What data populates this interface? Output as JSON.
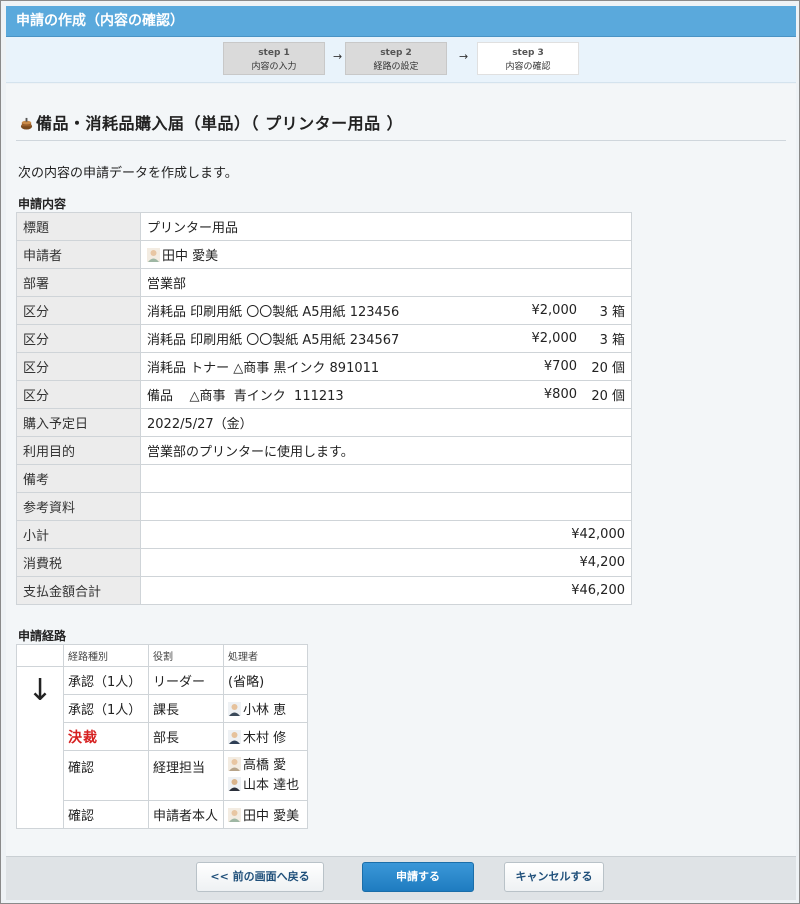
{
  "window": {
    "title": "申請の作成（内容の確認）"
  },
  "steps": [
    {
      "step": "step 1",
      "label": "内容の入力"
    },
    {
      "step": "step 2",
      "label": "経路の設定"
    },
    {
      "step": "step 3",
      "label": "内容の確認"
    }
  ],
  "arrow_glyph": "→",
  "form": {
    "title": "備品・消耗品購入届（単品）（ プリンター用品 ）",
    "intro": "次の内容の申請データを作成します。",
    "section_content": "申請内容",
    "rows": {
      "title": {
        "label": "標題",
        "value": "プリンター用品"
      },
      "applicant": {
        "label": "申請者",
        "value": "田中 愛美"
      },
      "dept": {
        "label": "部署",
        "value": "営業部"
      },
      "items": [
        {
          "label": "区分",
          "desc": "消耗品  印刷用紙  〇〇製紙  A5用紙  123456",
          "price": "¥2,000",
          "qty": "3  箱"
        },
        {
          "label": "区分",
          "desc": "消耗品  印刷用紙  〇〇製紙  A5用紙  234567",
          "price": "¥2,000",
          "qty": "3  箱"
        },
        {
          "label": "区分",
          "desc": "消耗品  トナー  △商事  黒インク  891011",
          "price": "¥700",
          "qty": "20  個"
        },
        {
          "label": "区分",
          "desc": "備品    △商事  青インク  111213",
          "price": "¥800",
          "qty": "20  個"
        }
      ],
      "purchase_date": {
        "label": "購入予定日",
        "value": "2022/5/27（金）"
      },
      "purpose": {
        "label": "利用目的",
        "value": "営業部のプリンターに使用します。"
      },
      "remarks": {
        "label": "備考",
        "value": ""
      },
      "reference": {
        "label": "参考資料",
        "value": ""
      },
      "subtotal": {
        "label": "小計",
        "value": "¥42,000"
      },
      "tax": {
        "label": "消費税",
        "value": "¥4,200"
      },
      "total": {
        "label": "支払金額合計",
        "value": "¥46,200"
      }
    },
    "section_route": "申請経路",
    "route": {
      "headers": [
        "経路種別",
        "役割",
        "処理者"
      ],
      "arrow": "↓",
      "rows": [
        {
          "type": "承認（1人）",
          "role": "リーダー",
          "persons": [
            "(省略)"
          ]
        },
        {
          "type": "承認（1人）",
          "role": "課長",
          "persons": [
            "小林 恵"
          ]
        },
        {
          "type": "決裁",
          "role": "部長",
          "persons": [
            "木村 修"
          ]
        },
        {
          "type": "確認",
          "role": "経理担当",
          "persons": [
            "高橋 愛",
            "山本 達也"
          ]
        },
        {
          "type": "確認",
          "role": "申請者本人",
          "persons": [
            "田中 愛美"
          ]
        }
      ]
    }
  },
  "buttons": {
    "back": "<< 前の画面へ戻る",
    "submit": "申請する",
    "cancel": "キャンセルする"
  },
  "colors": {
    "titlebar": "#5aa9dc",
    "primary_button": "#2b88cc",
    "kessai": "#d62020"
  }
}
